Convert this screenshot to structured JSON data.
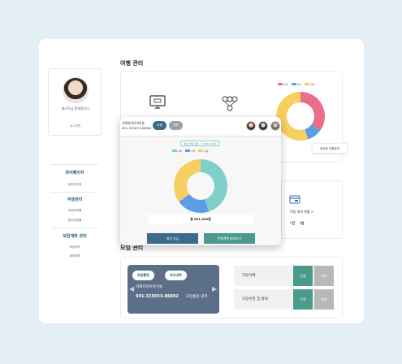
{
  "profile": {
    "welcome": "테스트님 환영합니다",
    "logout": "로그아웃"
  },
  "sidebar": {
    "sections": [
      {
        "title": "마이페이지",
        "items": [
          "내정보수정"
        ]
      },
      {
        "title": "여행관리",
        "items": [
          "저장된여행",
          "정산된여행"
        ]
      },
      {
        "title": "모임계좌 관리",
        "items": [
          "모임내역",
          "계좌내역"
        ]
      }
    ]
  },
  "main": {
    "travel_title": "여행 관리",
    "travel_icon1": "monitor-icon",
    "travel_icon2": "people-icon",
    "legend": [
      "숙박",
      "식비",
      "관광"
    ],
    "bg_badge": "정산된 여행경비",
    "mid": {
      "card_icon": "card-icon",
      "summary": "이달 회비 현황 >",
      "values": [
        {
          "mark": "0",
          "unit": "건",
          "color": "#e0446b"
        },
        {
          "mark": "0",
          "unit": "원",
          "color": "#e0446b"
        }
      ]
    },
    "meeting_title": "모임 관리"
  },
  "account_card": {
    "tab1": "모임통장",
    "tab2": "카드내역",
    "name": "서해지와이아이들",
    "number": "691-325033-86882",
    "link": "모임통장 내역"
  },
  "actions": [
    {
      "label": "자동이체",
      "btn1": "신청",
      "btn2": "해지"
    },
    {
      "label": "모임수정 및 탈퇴",
      "btn1": "수정",
      "btn2": "탈퇴"
    }
  ],
  "modal": {
    "name": "서해지와이아이들",
    "number": "691-325033-86882",
    "tab_active": "여행",
    "tab_inactive": "계좌",
    "badge": "예상 여행 경비 : 1,000,000원",
    "legend": [
      "숙박",
      "식비",
      "관광"
    ],
    "total": "총 691,000원",
    "btn_left": "회비 입금",
    "btn_right": "여행계획 짜러가기"
  },
  "colors": {
    "teal": "#7fd0c8",
    "blue": "#5b9ee6",
    "yellow": "#f7cf61",
    "pink": "#ea6d8a",
    "dark_blue": "#3b6a8a",
    "green_btn": "#4a9b8c",
    "grey_btn": "#b8b8b8"
  },
  "chart_data": [
    {
      "type": "pie",
      "categories": [
        "숙박",
        "식비",
        "관광"
      ],
      "values": [
        35,
        10,
        55
      ],
      "title": "",
      "xlabel": "",
      "ylabel": ""
    },
    {
      "type": "pie",
      "categories": [
        "숙박",
        "식비",
        "관광"
      ],
      "values": [
        45,
        20,
        35
      ],
      "title": "",
      "xlabel": "",
      "ylabel": ""
    }
  ]
}
